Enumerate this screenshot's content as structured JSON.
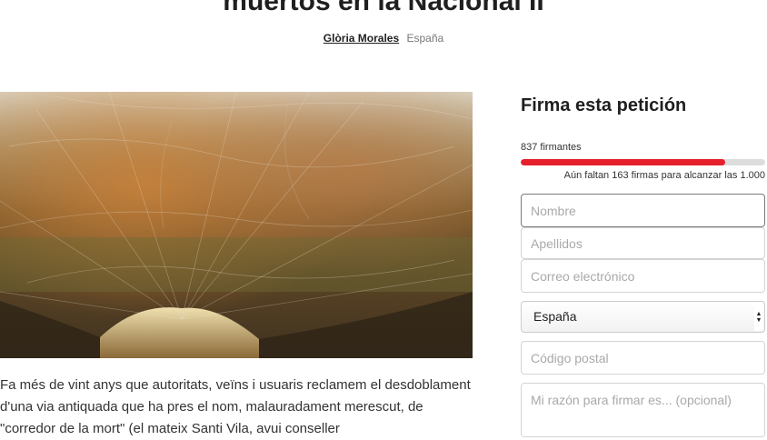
{
  "article": {
    "title": "muertos en la Nacional II",
    "author": "Glòria Morales",
    "country": "España",
    "body": "Fa més de vint anys que autoritats, veïns i usuaris reclamem el desdoblament d'una via antiquada que ha pres el nom, malauradament merescut, de \"corredor de la mort\" (el mateix Santi Vila, avui conseller"
  },
  "petition": {
    "heading": "Firma esta petición",
    "signers_label": "837 firmantes",
    "progress_fraction": 0.837,
    "remaining_text": "Aún faltan 163 firmas para alcanzar las 1.000",
    "accent_color": "#e5202b"
  },
  "form": {
    "first_name_placeholder": "Nombre",
    "last_name_placeholder": "Apellidos",
    "email_placeholder": "Correo electrónico",
    "country_selected": "España",
    "postal_placeholder": "Código postal",
    "reason_placeholder": "Mi razón para firmar es... (opcional)"
  }
}
